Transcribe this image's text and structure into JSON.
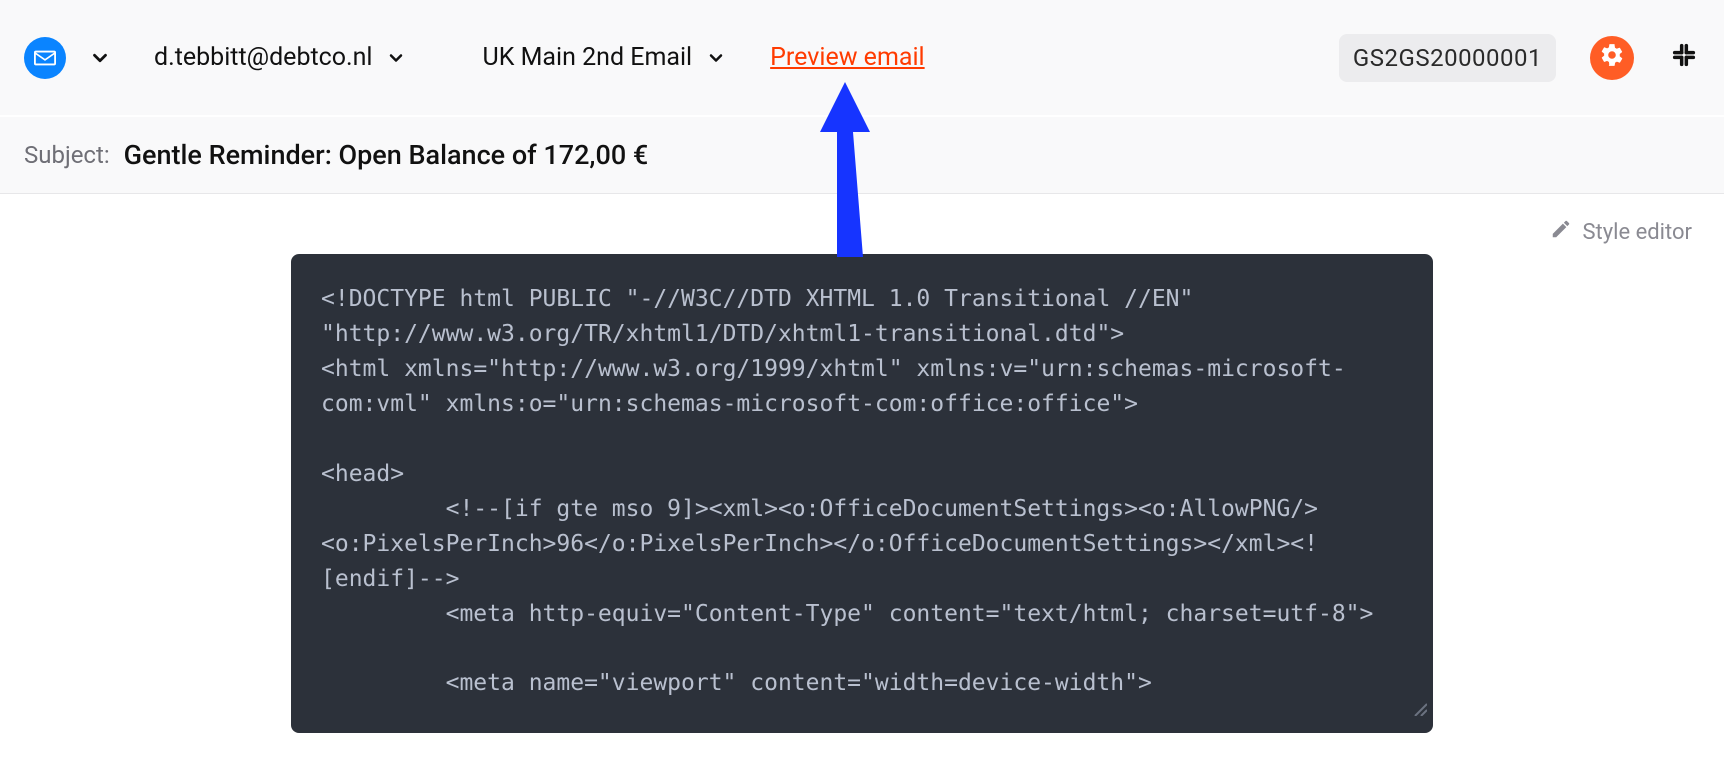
{
  "header": {
    "recipient": "d.tebbitt@debtco.nl",
    "template": "UK Main 2nd Email",
    "preview_link": "Preview email",
    "reference": "GS2GS20000001"
  },
  "subject": {
    "label": "Subject:",
    "value": "Gentle Reminder: Open Balance of 172,00 €"
  },
  "toolbar": {
    "style_editor": "Style editor"
  },
  "code": {
    "l1": "<!DOCTYPE html PUBLIC \"-//W3C//DTD XHTML 1.0 Transitional //EN\" \"http://www.w3.org/TR/xhtml1/DTD/xhtml1-transitional.dtd\">",
    "l2": "<html xmlns=\"http://www.w3.org/1999/xhtml\" xmlns:v=\"urn:schemas-microsoft-com:vml\" xmlns:o=\"urn:schemas-microsoft-com:office:office\">",
    "blank": "",
    "l3": "<head>",
    "l4a": "<!--[if gte mso 9]><xml><o:OfficeDocumentSettings><o:AllowPNG/>",
    "l4b": "<o:PixelsPerInch>96</o:PixelsPerInch></o:OfficeDocumentSettings></xml><![endif]-->",
    "l5": "<meta http-equiv=\"Content-Type\" content=\"text/html; charset=utf-8\">",
    "l6": "<meta name=\"viewport\" content=\"width=device-width\">"
  }
}
